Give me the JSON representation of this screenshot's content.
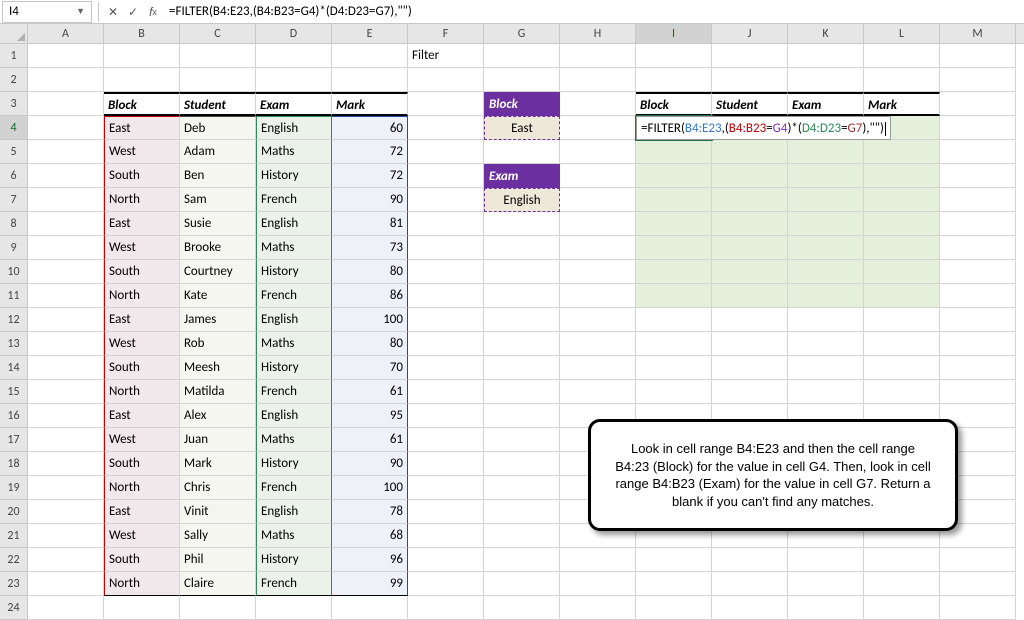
{
  "namebox": {
    "ref": "I4"
  },
  "formula_bar": {
    "value": "=FILTER(B4:E23,(B4:B23=G4)*(D4:D23=G7),\"\")"
  },
  "columns": [
    "A",
    "B",
    "C",
    "D",
    "E",
    "F",
    "G",
    "H",
    "I",
    "J",
    "K",
    "L",
    "M"
  ],
  "active_col": "I",
  "active_row": 4,
  "row_count": 24,
  "sheet": {
    "F1": "Filter",
    "table_headers": {
      "b": "Block",
      "c": "Student",
      "d": "Exam",
      "e": "Mark"
    },
    "filter_labels": {
      "block": "Block",
      "exam": "Exam"
    },
    "filter_values": {
      "block": "East",
      "exam": "English"
    },
    "result_headers": {
      "i": "Block",
      "j": "Student",
      "k": "Exam",
      "l": "Mark"
    },
    "data": [
      {
        "block": "East",
        "student": "Deb",
        "exam": "English",
        "mark": 60
      },
      {
        "block": "West",
        "student": "Adam",
        "exam": "Maths",
        "mark": 72
      },
      {
        "block": "South",
        "student": "Ben",
        "exam": "History",
        "mark": 72
      },
      {
        "block": "North",
        "student": "Sam",
        "exam": "French",
        "mark": 90
      },
      {
        "block": "East",
        "student": "Susie",
        "exam": "English",
        "mark": 81
      },
      {
        "block": "West",
        "student": "Brooke",
        "exam": "Maths",
        "mark": 73
      },
      {
        "block": "South",
        "student": "Courtney",
        "exam": "History",
        "mark": 80
      },
      {
        "block": "North",
        "student": "Kate",
        "exam": "French",
        "mark": 86
      },
      {
        "block": "East",
        "student": "James",
        "exam": "English",
        "mark": 100
      },
      {
        "block": "West",
        "student": "Rob",
        "exam": "Maths",
        "mark": 80
      },
      {
        "block": "South",
        "student": "Meesh",
        "exam": "History",
        "mark": 70
      },
      {
        "block": "North",
        "student": "Matilda",
        "exam": "French",
        "mark": 61
      },
      {
        "block": "East",
        "student": "Alex",
        "exam": "English",
        "mark": 95
      },
      {
        "block": "West",
        "student": "Juan",
        "exam": "Maths",
        "mark": 61
      },
      {
        "block": "South",
        "student": "Mark",
        "exam": "History",
        "mark": 90
      },
      {
        "block": "North",
        "student": "Chris",
        "exam": "French",
        "mark": 100
      },
      {
        "block": "East",
        "student": "Vinit",
        "exam": "English",
        "mark": 78
      },
      {
        "block": "West",
        "student": "Sally",
        "exam": "Maths",
        "mark": 68
      },
      {
        "block": "South",
        "student": "Phil",
        "exam": "History",
        "mark": 96
      },
      {
        "block": "North",
        "student": "Claire",
        "exam": "French",
        "mark": 99
      }
    ],
    "formula_tokens": [
      {
        "t": "=FILTER(",
        "c": ""
      },
      {
        "t": "B4:E23",
        "c": "token-blue"
      },
      {
        "t": ",(",
        "c": ""
      },
      {
        "t": "B4:B23",
        "c": "token-red"
      },
      {
        "t": "=",
        "c": ""
      },
      {
        "t": "G4",
        "c": "token-purple"
      },
      {
        "t": ")*(",
        "c": ""
      },
      {
        "t": "D4:D23",
        "c": "token-green"
      },
      {
        "t": "=",
        "c": ""
      },
      {
        "t": "G7",
        "c": "token-darkred"
      },
      {
        "t": "),\"\")",
        "c": ""
      }
    ]
  },
  "callout": "Look in cell range B4:E23 and then the cell range B4:23 (Block) for the value in cell G4. Then, look in cell range B4:B23 (Exam) for the value in cell G7. Return a blank if you can't find any matches."
}
